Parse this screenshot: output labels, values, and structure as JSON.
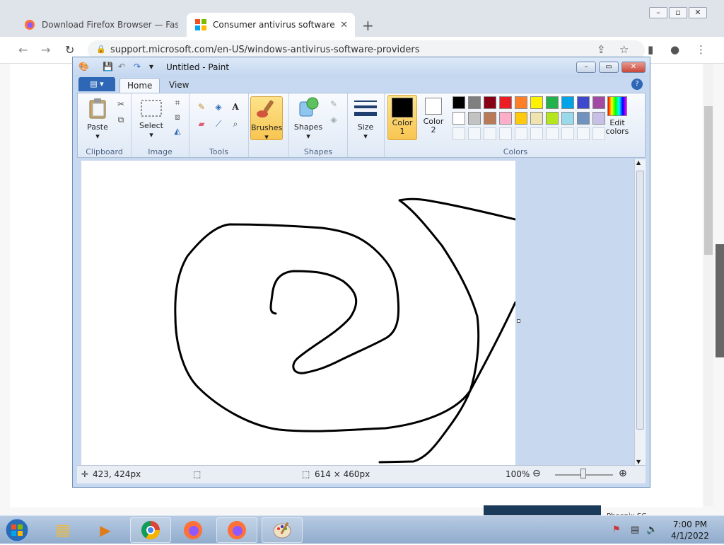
{
  "browser": {
    "tabs": [
      {
        "title": "Download Firefox Browser — Fas",
        "active": false
      },
      {
        "title": "Consumer antivirus software pro",
        "active": true
      }
    ],
    "new_tab": "+",
    "url": "support.microsoft.com/en-US/windows-antivirus-software-providers"
  },
  "paint": {
    "title": "Untitled - Paint",
    "ribbon_tabs": [
      "Home",
      "View"
    ],
    "groups": {
      "clipboard": {
        "label": "Clipboard",
        "paste": "Paste"
      },
      "image": {
        "label": "Image",
        "select": "Select"
      },
      "tools": {
        "label": "Tools"
      },
      "brushes": "Brushes",
      "shapes": {
        "label": "Shapes",
        "button": "Shapes"
      },
      "size": "Size",
      "colors": {
        "label": "Colors",
        "color1": "Color 1",
        "color2": "Color 2",
        "edit": "Edit colors"
      }
    },
    "palette_row1": [
      "#000000",
      "#7f7f7f",
      "#880015",
      "#ed1c24",
      "#ff7f27",
      "#fff200",
      "#22b14c",
      "#00a2e8",
      "#3f48cc",
      "#a349a4"
    ],
    "palette_row2": [
      "#ffffff",
      "#c3c3c3",
      "#b97a57",
      "#ffaec9",
      "#ffc90e",
      "#efe4b0",
      "#b5e61d",
      "#99d9ea",
      "#7092be",
      "#c8bfe7"
    ],
    "status": {
      "cursor": "423, 424px",
      "size": "614 × 460px",
      "zoom": "100%"
    }
  },
  "taskbar": {
    "time": "7:00 PM",
    "date": "4/1/2022"
  },
  "behind_window": {
    "text": "Phoenix SC"
  }
}
